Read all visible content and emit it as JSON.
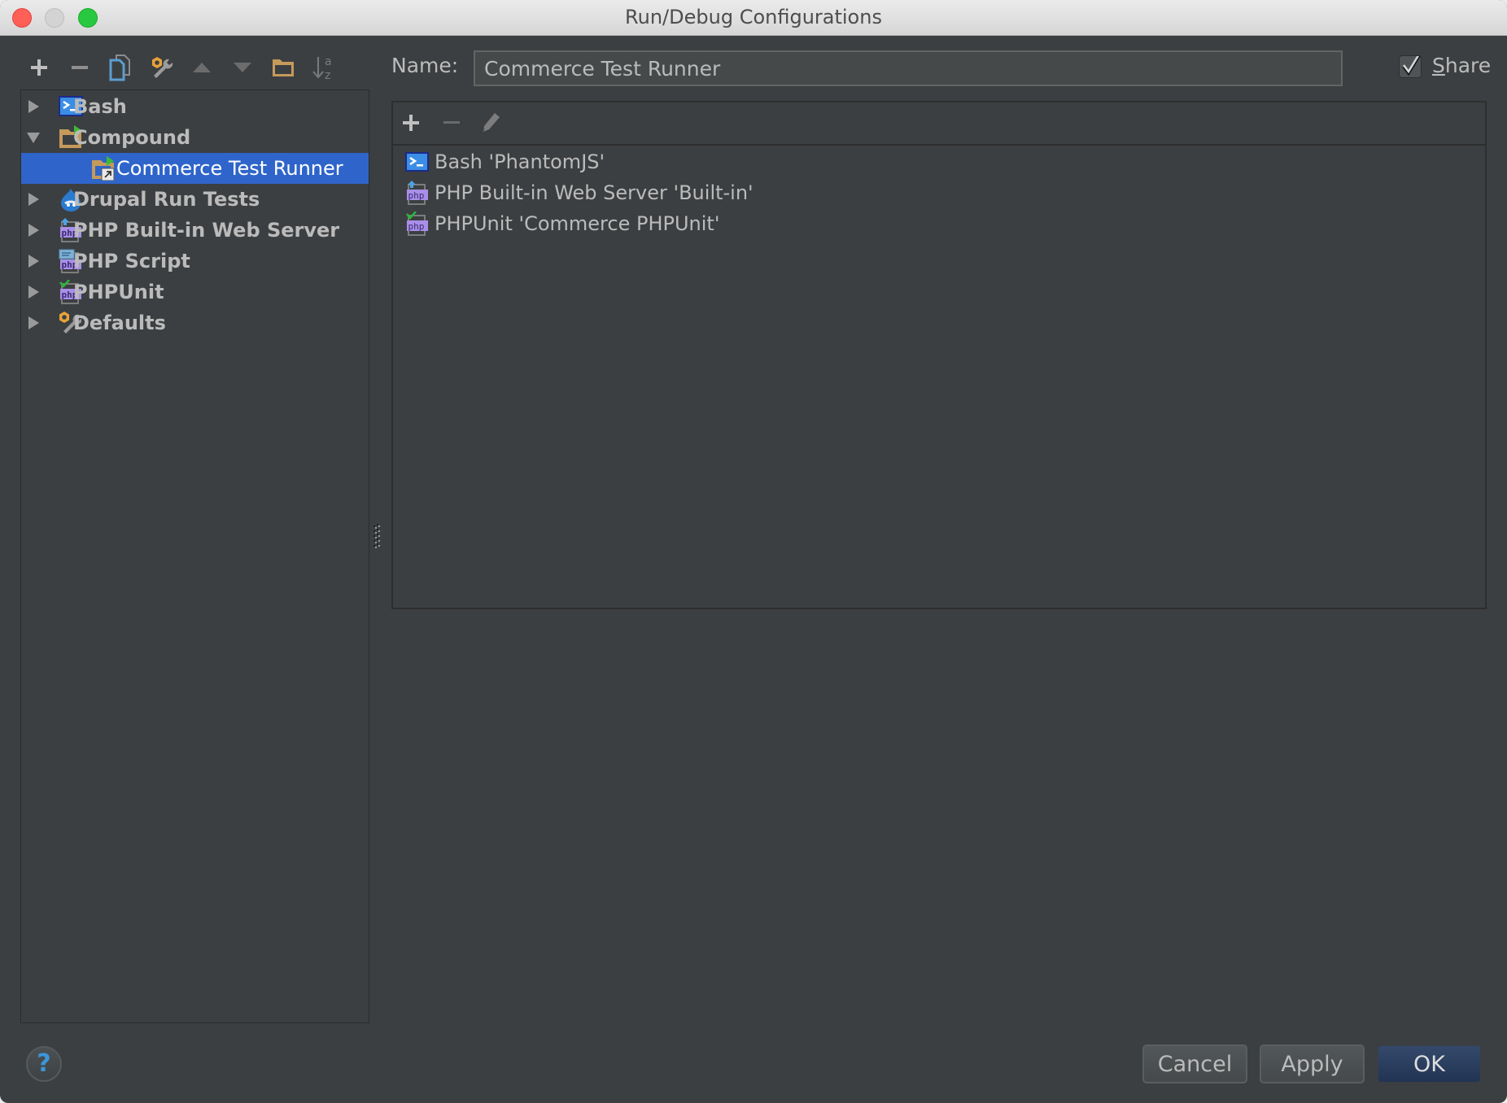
{
  "window": {
    "title": "Run/Debug Configurations"
  },
  "toolbar": {
    "items": [
      {
        "icon": "add-icon",
        "label": "Add New Configuration"
      },
      {
        "icon": "remove-icon",
        "label": "Remove Configuration"
      },
      {
        "icon": "copy-icon",
        "label": "Copy Configuration"
      },
      {
        "icon": "wrench-icon",
        "label": "Edit Defaults"
      },
      {
        "icon": "move-up-icon",
        "label": "Move Up"
      },
      {
        "icon": "move-down-icon",
        "label": "Move Down"
      },
      {
        "icon": "folder-icon",
        "label": "Create New Folder"
      },
      {
        "icon": "sort-alpha-icon",
        "label": "Sort Configurations"
      }
    ]
  },
  "tree": {
    "items": [
      {
        "label": "Bash",
        "icon": "bash-icon",
        "expanded": false,
        "level": 0
      },
      {
        "label": "Compound",
        "icon": "compound-folder-icon",
        "expanded": true,
        "level": 0
      },
      {
        "label": "Commerce Test Runner",
        "icon": "compound-config-icon",
        "selected": true,
        "level": 1
      },
      {
        "label": "Drupal Run Tests",
        "icon": "drupal-icon",
        "expanded": false,
        "level": 0
      },
      {
        "label": "PHP Built-in Web Server",
        "icon": "php-server-icon",
        "expanded": false,
        "level": 0
      },
      {
        "label": "PHP Script",
        "icon": "php-script-icon",
        "expanded": false,
        "level": 0
      },
      {
        "label": "PHPUnit",
        "icon": "phpunit-icon",
        "expanded": false,
        "level": 0
      },
      {
        "label": "Defaults",
        "icon": "defaults-wrench-icon",
        "expanded": false,
        "level": 0
      }
    ]
  },
  "form": {
    "name_label": "Name:",
    "name_value": "Commerce Test Runner",
    "share_label_mnemonic": "S",
    "share_label_rest": "hare",
    "share_checked": true
  },
  "panel": {
    "toolbar": [
      {
        "icon": "add-icon",
        "label": "Add"
      },
      {
        "icon": "remove-icon",
        "label": "Remove"
      },
      {
        "icon": "edit-pencil-icon",
        "label": "Edit"
      }
    ],
    "items": [
      {
        "label": "Bash 'PhantomJS'",
        "icon": "bash-icon"
      },
      {
        "label": "PHP Built-in Web Server 'Built-in'",
        "icon": "php-server-icon"
      },
      {
        "label": "PHPUnit 'Commerce PHPUnit'",
        "icon": "phpunit-icon"
      }
    ]
  },
  "footer": {
    "help_label": "?",
    "cancel_label": "Cancel",
    "apply_label": "Apply",
    "ok_label": "OK"
  },
  "colors": {
    "background": "#3c3f41",
    "selection": "#2f65ca",
    "text": "#bbbbbb",
    "ok_button": "#2b4063"
  }
}
